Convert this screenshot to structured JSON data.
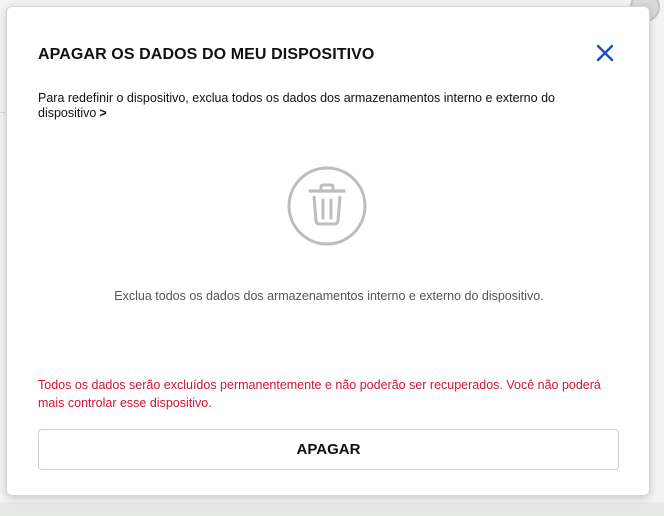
{
  "dialog": {
    "title": "APAGAR OS DADOS DO MEU DISPOSITIVO",
    "subtitle": "Para redefinir o dispositivo, exclua todos os dados dos armazenamentos interno e externo do dispositivo",
    "subtitle_chevron": ">",
    "illustration_icon": "trash-icon",
    "info_text": "Exclua todos os dados dos armazenamentos interno e externo do dispositivo.",
    "warning_text": "Todos os dados serão excluídos permanentemente e não poderão ser recuperados. Você não poderá mais controlar esse dispositivo.",
    "confirm_button_label": "APAGAR",
    "close_icon": "close-icon"
  },
  "colors": {
    "accent": "#1a4fc4",
    "warning": "#d11434",
    "icon_gray": "#bdbdbd",
    "text": "#111111",
    "muted_text": "#555555"
  }
}
